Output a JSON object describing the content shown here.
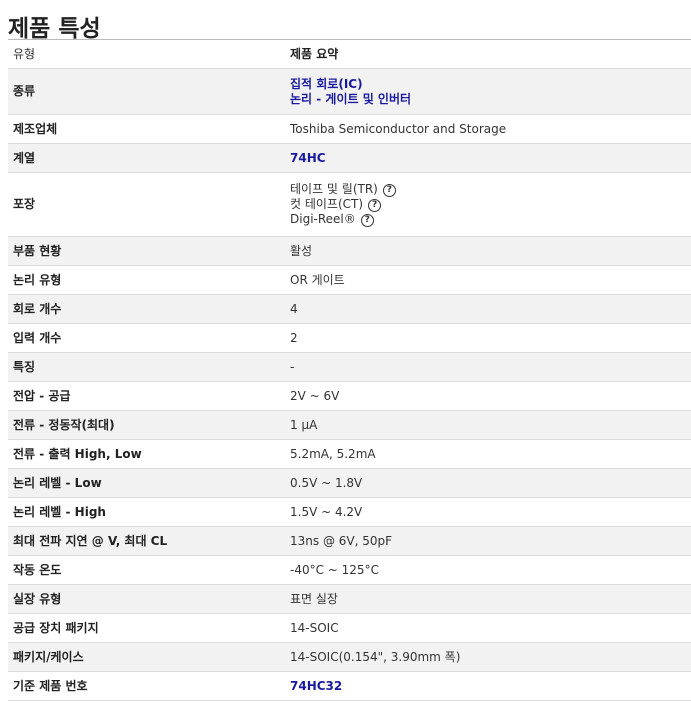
{
  "title": "제품 특성",
  "header": {
    "type_label": "유형",
    "summary_label": "제품 요약"
  },
  "rows": [
    {
      "label": "종류",
      "values": [
        "집적 회로(IC)",
        "논리 - 게이트 및 인버터"
      ]
    },
    {
      "label": "제조업체",
      "value": "Toshiba Semiconductor and Storage"
    },
    {
      "label": "계열",
      "value": "74HC"
    },
    {
      "label": "포장",
      "values": [
        "테이프 및 릴(TR)",
        "컷 테이프(CT)",
        "Digi-Reel®"
      ]
    },
    {
      "label": "부품 현황",
      "value": "활성"
    },
    {
      "label": "논리 유형",
      "value": "OR 게이트"
    },
    {
      "label": "회로 개수",
      "value": "4"
    },
    {
      "label": "입력 개수",
      "value": "2"
    },
    {
      "label": "특징",
      "value": "-"
    },
    {
      "label": "전압 - 공급",
      "value": "2V ~ 6V"
    },
    {
      "label": "전류 - 정동작(최대)",
      "value": "1 µA"
    },
    {
      "label": "전류 - 출력 High, Low",
      "value": "5.2mA, 5.2mA"
    },
    {
      "label": "논리 레벨 - Low",
      "value": "0.5V ~ 1.8V"
    },
    {
      "label": "논리 레벨 - High",
      "value": "1.5V ~ 4.2V"
    },
    {
      "label": "최대 전파 지연 @ V, 최대 CL",
      "value": "13ns @ 6V, 50pF"
    },
    {
      "label": "작동 온도",
      "value": "-40°C ~ 125°C"
    },
    {
      "label": "실장 유형",
      "value": "표면 실장"
    },
    {
      "label": "공급 장치 패키지",
      "value": "14-SOIC"
    },
    {
      "label": "패키지/케이스",
      "value": "14-SOIC(0.154\", 3.90mm 폭)"
    },
    {
      "label": "기준 제품 번호",
      "value": "74HC32"
    }
  ],
  "help_icon_glyph": "?",
  "colors": {
    "link": "#1a1aa0",
    "stripe": "#f2f2f2"
  }
}
